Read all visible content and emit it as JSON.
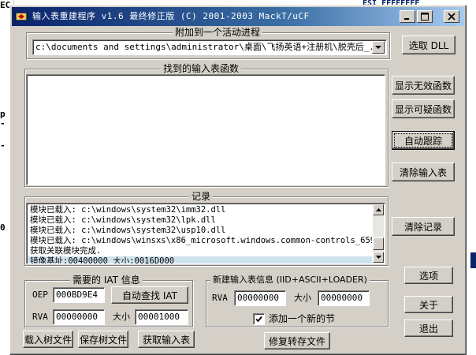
{
  "background": {
    "top_text": "ESI FFFFFFFF",
    "left_fragments": [
      "EC",
      "p",
      "-",
      "-",
      "0"
    ]
  },
  "window": {
    "title": "输入表重建程序 v1.6 最终修正版 (C) 2001-2003 MackT/uCF"
  },
  "attach": {
    "legend": "附加到一个活动进程",
    "process_path": "c:\\documents and settings\\administrator\\桌面\\飞扬英语+注册机\\脱壳后_.ex",
    "select_dll_label": "选取 DLL"
  },
  "imports": {
    "legend": "找到的输入表函数"
  },
  "side_buttons": {
    "show_invalid": "显示无效函数",
    "show_suspect": "显示可疑函数",
    "auto_trace": "自动跟踪",
    "clear_imports": "清除输入表",
    "clear_log": "清除记录"
  },
  "log": {
    "legend": "记录",
    "lines": [
      "模块已载入: c:\\windows\\system32\\imm32.dll",
      "模块已载入: c:\\windows\\system32\\lpk.dll",
      "模块已载入: c:\\windows\\system32\\usp10.dll",
      "模块已载入: c:\\windows\\winsxs\\x86_microsoft.windows.common-controls_659",
      "获取关联模块完成.",
      "镜像基址:00400000 大小:0016D000"
    ]
  },
  "iat": {
    "legend": "需要的 IAT 信息",
    "oep_label": "OEP",
    "oep_value": "000BD9E4",
    "auto_search_label": "自动查找 IAT",
    "rva_label": "RVA",
    "rva_value": "00000000",
    "size_label": "大小",
    "size_value": "00001000"
  },
  "new_section": {
    "legend": "新建输入表信息 (IID+ASCII+LOADER)",
    "rva_label": "RVA",
    "rva_value": "00000000",
    "size_label": "大小",
    "size_value": "00000000",
    "add_section_label": "添加一个新的节",
    "add_section_checked": true
  },
  "bottom_buttons": {
    "load_tree": "载入树文件",
    "save_tree": "保存树文件",
    "get_imports": "获取输入表",
    "fix_dump": "修复转存文件"
  },
  "right_buttons": {
    "options": "选项",
    "about": "关于",
    "exit": "退出"
  },
  "colors": {
    "title_start": "#0a246a",
    "title_end": "#a6caf0",
    "face": "#d4d0c8",
    "log_selection": "#cfe3ef"
  }
}
